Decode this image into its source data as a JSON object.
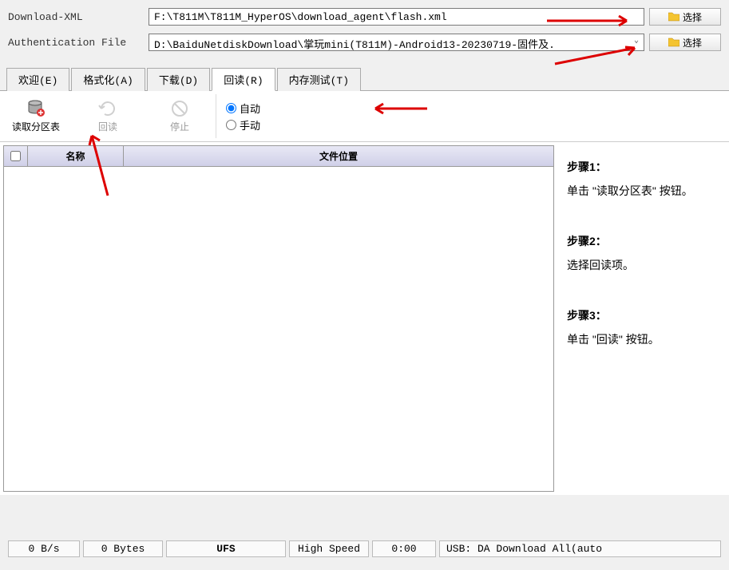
{
  "file_rows": {
    "xml": {
      "label": "Download-XML",
      "value": "F:\\T811M\\T811M_HyperOS\\download_agent\\flash.xml",
      "browse": "选择"
    },
    "auth": {
      "label": "Authentication File",
      "value": "D:\\BaiduNetdiskDownload\\掌玩mini(T811M)-Android13-20230719-固件及.",
      "browse": "选择"
    }
  },
  "tabs": [
    {
      "label": "欢迎(E)"
    },
    {
      "label": "格式化(A)"
    },
    {
      "label": "下载(D)"
    },
    {
      "label": "回读(R)",
      "active": true
    },
    {
      "label": "内存测试(T)"
    }
  ],
  "toolbar": {
    "read_table": "读取分区表",
    "readback": "回读",
    "stop": "停止"
  },
  "radio": {
    "auto": "自动",
    "manual": "手动"
  },
  "table": {
    "col_name": "名称",
    "col_loc": "文件位置"
  },
  "steps": [
    {
      "title": "步骤1：",
      "text": "单击 \"读取分区表\" 按钮。"
    },
    {
      "title": "步骤2：",
      "text": "选择回读项。"
    },
    {
      "title": "步骤3：",
      "text": "单击 \"回读\" 按钮。"
    }
  ],
  "status": {
    "speed": "0 B/s",
    "bytes": "0 Bytes",
    "storage": "UFS",
    "mode": "High Speed",
    "time": "0:00",
    "usb": "USB: DA Download All(auto"
  }
}
